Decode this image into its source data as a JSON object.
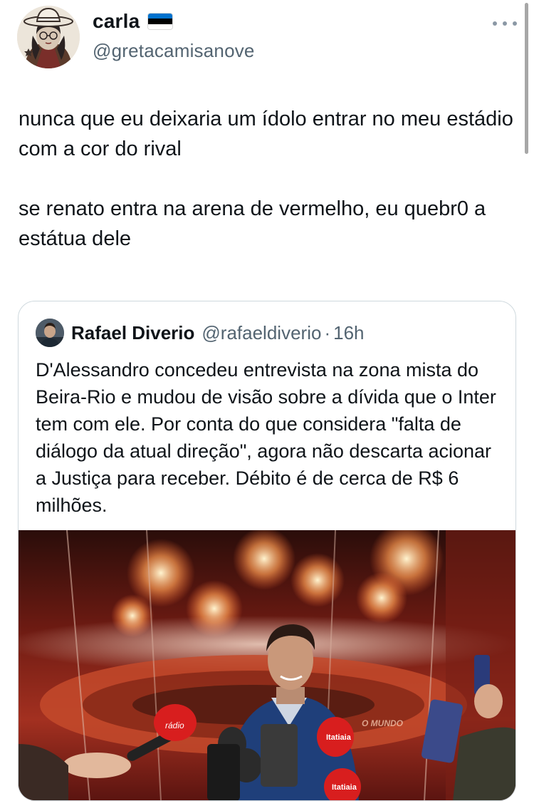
{
  "tweet": {
    "author": {
      "display_name": "carla",
      "flag": "estonia-flag",
      "handle": "@gretacamisanove"
    },
    "paragraphs": [
      "nunca que eu deixaria um ídolo entrar no meu estádio com a cor do rival",
      "se renato entra na arena de vermelho, eu quebr0 a estátua dele"
    ]
  },
  "quoted_tweet": {
    "author": {
      "display_name": "Rafael Diverio",
      "handle": "@rafaeldiverio",
      "separator": "·",
      "time": "16h"
    },
    "text": "D'Alessandro concedeu entrevista na zona mista do Beira-Rio e mudou de visão sobre a dívida que o Inter tem com ele. Por conta do que considera \"falta de diálogo da atual direção\", agora não descarta acionar a Justiça para receber. Débito é de cerca de R$ 6 milhões.",
    "image": {
      "mic_labels": [
        "rádio",
        "Itatiaia",
        "Itatiaia"
      ],
      "banner_text": "O MUNDO"
    }
  },
  "colors": {
    "text_primary": "#0f1419",
    "text_secondary": "#536471",
    "border": "#cfd9de",
    "flag_blue": "#0072CE",
    "flag_black": "#000000",
    "flag_white": "#FFFFFF"
  }
}
